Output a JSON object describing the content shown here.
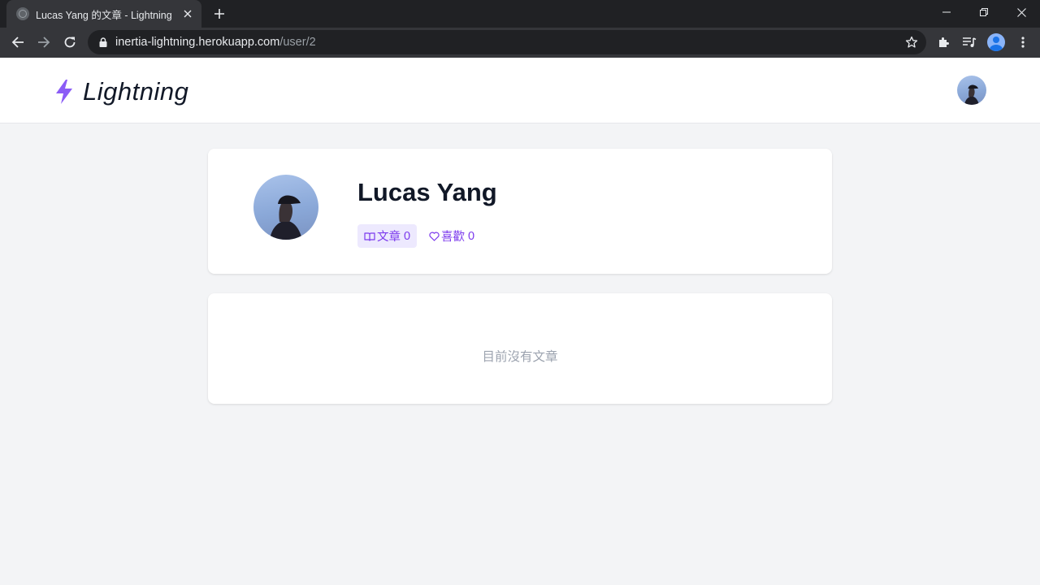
{
  "browser": {
    "tab_title": "Lucas Yang 的文章 - Lightning",
    "url_host": "inertia-lightning.herokuapp.com",
    "url_path": "/user/2"
  },
  "header": {
    "logo_text": "Lightning"
  },
  "profile": {
    "name": "Lucas Yang",
    "posts_label": "文章",
    "posts_count": "0",
    "likes_label": "喜歡",
    "likes_count": "0"
  },
  "empty_state": {
    "message": "目前沒有文章"
  },
  "colors": {
    "accent": "#8b5cf6",
    "accent_bg": "#ede9fe",
    "page_bg": "#f3f4f6"
  }
}
